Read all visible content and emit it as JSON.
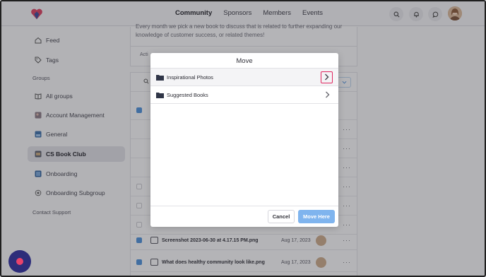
{
  "header": {
    "nav": [
      {
        "label": "Community",
        "active": true
      },
      {
        "label": "Sponsors",
        "active": false
      },
      {
        "label": "Members",
        "active": false
      },
      {
        "label": "Events",
        "active": false
      }
    ],
    "icons": [
      "search-icon",
      "bell-icon",
      "chat-icon"
    ]
  },
  "sidebar": {
    "feed": "Feed",
    "tags": "Tags",
    "groups_heading": "Groups",
    "items": [
      {
        "label": "All groups",
        "icon": "book-icon"
      },
      {
        "label": "Account Management",
        "icon": "group-image-icon"
      },
      {
        "label": "General",
        "icon": "group-image-icon"
      },
      {
        "label": "CS Book Club",
        "icon": "group-image-icon",
        "active": true
      },
      {
        "label": "Onboarding",
        "icon": "group-image-icon"
      },
      {
        "label": "Onboarding Subgroup",
        "icon": "circle-icon"
      }
    ],
    "contact": "Contact Support"
  },
  "main": {
    "description": "Every month we pick a new book to discuss that is related to further expanding our knowledge of customer success, or related themes!",
    "tab_partial": "Acti",
    "rows": [
      {
        "name": "Screenshot 2023-06-30 at 4.17.15 PM.png",
        "date": "Aug 17, 2023"
      },
      {
        "name": "What does healthy community look like.png",
        "date": "Aug 17, 2023"
      }
    ]
  },
  "modal": {
    "title": "Move",
    "folders": [
      {
        "label": "Inspirational Photos"
      },
      {
        "label": "Suggested Books"
      }
    ],
    "cancel_label": "Cancel",
    "move_label": "Move Here"
  },
  "colors": {
    "accent": "#7fb4ee",
    "highlight": "#e0245e",
    "fab": "#2d2d7a"
  }
}
